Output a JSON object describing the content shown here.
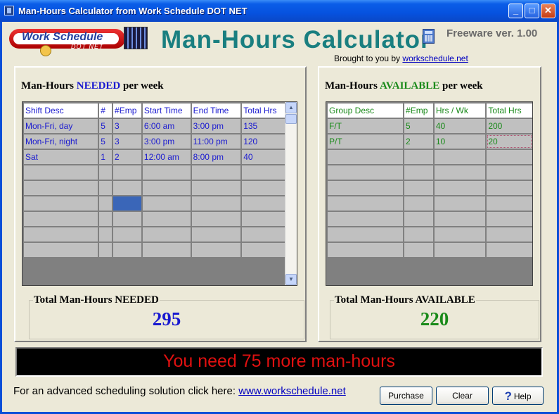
{
  "window": {
    "title": "Man-Hours Calculator from Work Schedule DOT NET"
  },
  "titlebar_buttons": {
    "minimize": "_",
    "maximize": "□",
    "close": "✕"
  },
  "header": {
    "logo_text": "Work Schedule",
    "logo_sub": "DOT NET",
    "title": "Man-Hours Calculator",
    "version": "Freeware ver. 1.00",
    "brought_prefix": "Brought to you by ",
    "brought_link": "workschedule.net"
  },
  "needed": {
    "heading_prefix": "Man-Hours ",
    "heading_emph": "NEEDED",
    "heading_suffix": " per week",
    "columns": [
      "Shift Desc",
      "#",
      "#Emp",
      "Start Time",
      "End Time",
      "Total Hrs"
    ],
    "rows": [
      [
        "Mon-Fri, day",
        "5",
        "3",
        "6:00 am",
        "3:00 pm",
        "135"
      ],
      [
        "Mon-Fri, night",
        "5",
        "3",
        "3:00 pm",
        "11:00 pm",
        "120"
      ],
      [
        "Sat",
        "1",
        "2",
        "12:00 am",
        "8:00 pm",
        "40"
      ],
      [
        "",
        "",
        "",
        "",
        "",
        ""
      ],
      [
        "",
        "",
        "",
        "",
        "",
        ""
      ],
      [
        "",
        "",
        "",
        "",
        "",
        ""
      ],
      [
        "",
        "",
        "",
        "",
        "",
        ""
      ],
      [
        "",
        "",
        "",
        "",
        "",
        ""
      ],
      [
        "",
        "",
        "",
        "",
        "",
        ""
      ]
    ],
    "total_label": "Total Man-Hours NEEDED",
    "total_value": "295",
    "scroll_up": "▲",
    "scroll_down": "▼"
  },
  "available": {
    "heading_prefix": "Man-Hours ",
    "heading_emph": "AVAILABLE",
    "heading_suffix": "  per week",
    "columns": [
      "Group Desc",
      "#Emp",
      "Hrs / Wk",
      "Total Hrs"
    ],
    "rows": [
      [
        "F/T",
        "5",
        "40",
        "200"
      ],
      [
        "P/T",
        "2",
        "10",
        "20"
      ],
      [
        "",
        "",
        "",
        ""
      ],
      [
        "",
        "",
        "",
        ""
      ],
      [
        "",
        "",
        "",
        ""
      ],
      [
        "",
        "",
        "",
        ""
      ],
      [
        "",
        "",
        "",
        ""
      ],
      [
        "",
        "",
        "",
        ""
      ],
      [
        "",
        "",
        "",
        ""
      ]
    ],
    "total_label": "Total Man-Hours AVAILABLE",
    "total_value": "220"
  },
  "message": "You need 75 more man-hours",
  "footer": {
    "text": "For an advanced scheduling solution click here: ",
    "link": "www.workschedule.net"
  },
  "buttons": {
    "purchase": "Purchase",
    "clear": "Clear",
    "help": "Help",
    "help_icon": "?"
  },
  "colors": {
    "needed": "#1a1ad0",
    "available": "#1a8a1a",
    "teal": "#1a7f80",
    "message": "#e01010",
    "selected_cell": "#3a66b8"
  }
}
